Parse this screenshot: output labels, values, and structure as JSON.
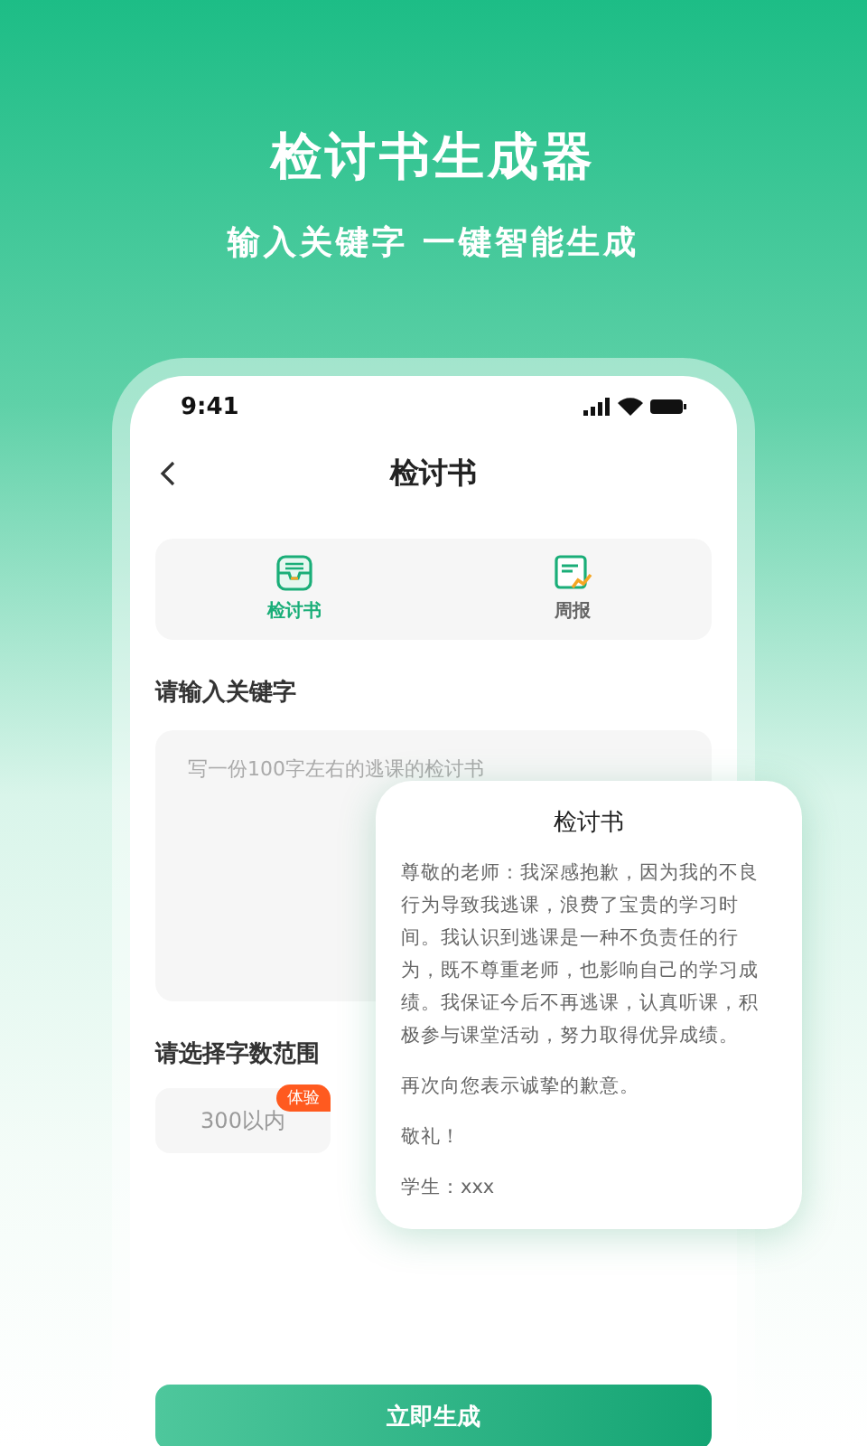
{
  "header": {
    "title": "检讨书生成器",
    "subtitle": "输入关键字 一键智能生成"
  },
  "status_bar": {
    "time": "9:41"
  },
  "nav": {
    "title": "检讨书"
  },
  "tabs": [
    {
      "label": "检讨书",
      "selected": true,
      "kind": "tray"
    },
    {
      "label": "周报",
      "selected": false,
      "kind": "report"
    }
  ],
  "keyword": {
    "label": "请输入关键字",
    "placeholder": "写一份100字左右的逃课的检讨书"
  },
  "word_range": {
    "label": "请选择字数范围",
    "options": [
      {
        "label": "300以内",
        "badge": "体验",
        "selected": false
      }
    ]
  },
  "generate_button": "立即生成",
  "preview": {
    "title": "检讨书",
    "paragraphs": [
      "尊敬的老师：我深感抱歉，因为我的不良行为导致我逃课，浪费了宝贵的学习时间。我认识到逃课是一种不负责任的行为，既不尊重老师，也影响自己的学习成绩。我保证今后不再逃课，认真听课，积极参与课堂活动，努力取得优异成绩。",
      "再次向您表示诚挚的歉意。",
      "敬礼！",
      "学生：xxx"
    ]
  }
}
